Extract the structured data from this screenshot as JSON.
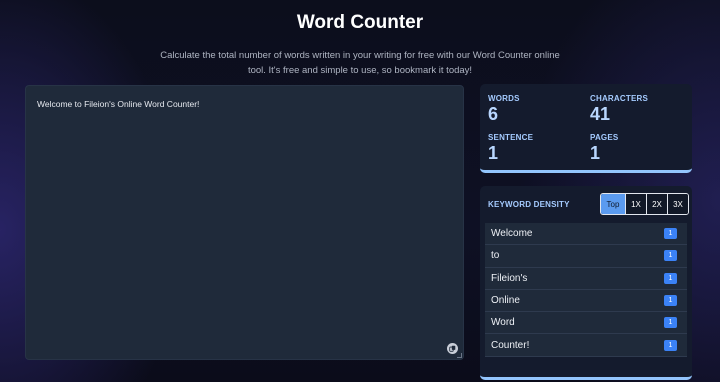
{
  "header": {
    "title": "Word Counter",
    "subtitle": "Calculate the total number of words written in your writing for free with our Word Counter online tool. It's free and simple to use, so bookmark it today!"
  },
  "editor": {
    "text": "Welcome to Fileion's Online Word Counter!",
    "copy_icon": "copy-icon"
  },
  "stats": {
    "words_label": "WORDS",
    "words_value": "6",
    "characters_label": "CHARACTERS",
    "characters_value": "41",
    "sentence_label": "SENTENCE",
    "sentence_value": "1",
    "pages_label": "PAGES",
    "pages_value": "1"
  },
  "keyword_density": {
    "title": "KEYWORD DENSITY",
    "tabs": [
      "Top",
      "1X",
      "2X",
      "3X"
    ],
    "active_tab": "Top",
    "keywords": [
      {
        "word": "Welcome",
        "count": "1"
      },
      {
        "word": "to",
        "count": "1"
      },
      {
        "word": "Fileion's",
        "count": "1"
      },
      {
        "word": "Online",
        "count": "1"
      },
      {
        "word": "Word",
        "count": "1"
      },
      {
        "word": "Counter!",
        "count": "1"
      }
    ]
  },
  "colors": {
    "accent": "#93c5fd",
    "badge": "#3b82f6",
    "active_tab": "#5b9bf0",
    "panel": "#141b2d",
    "editor": "#1f2a3a"
  }
}
